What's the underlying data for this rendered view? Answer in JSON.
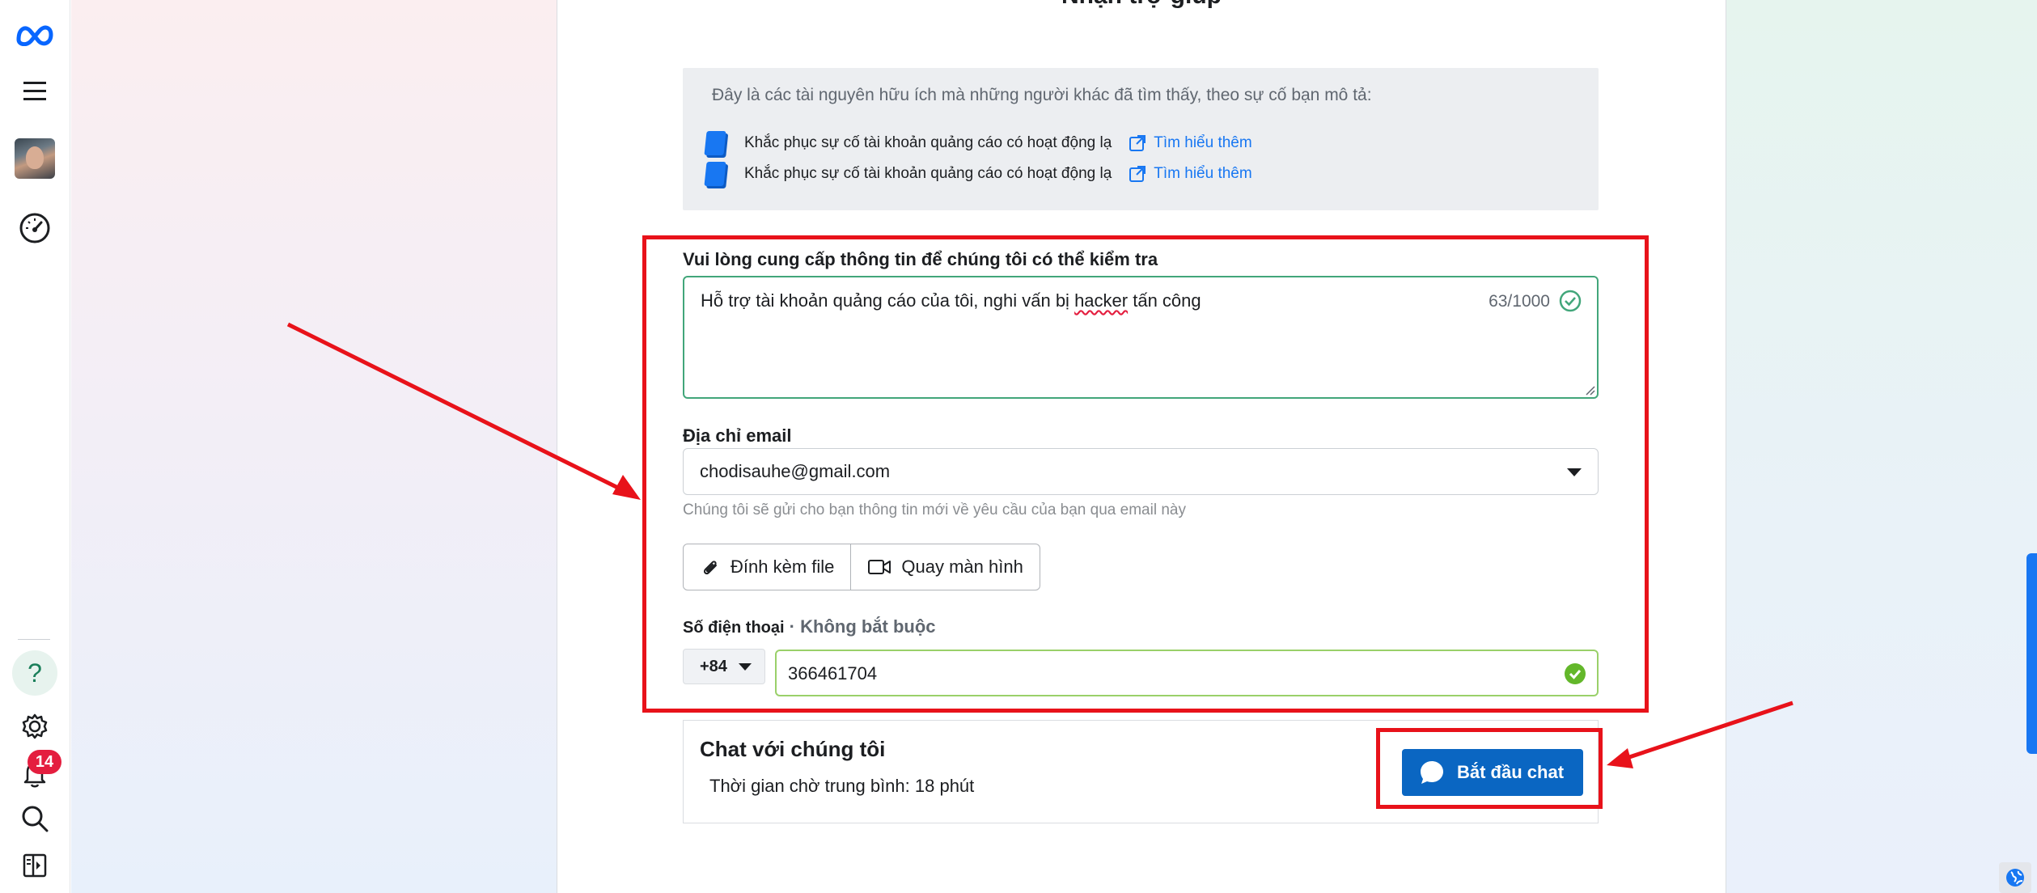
{
  "page_title": "Nhận trợ giúp",
  "resources": {
    "intro": "Đây là các tài nguyên hữu ích mà những người khác đã tìm thấy, theo sự cố bạn mô tả:",
    "items": [
      {
        "text": "Khắc phục sự cố tài khoản quảng cáo có hoạt động lạ",
        "link": "Tìm hiểu thêm"
      },
      {
        "text": "Khắc phục sự cố tài khoản quảng cáo có hoạt động lạ",
        "link": "Tìm hiểu thêm"
      }
    ]
  },
  "form": {
    "info_label": "Vui lòng cung cấp thông tin để chúng tôi có thể kiểm tra",
    "info_text_before": "Hỗ trợ tài khoản quảng cáo của tôi, nghi vấn bị ",
    "info_text_flagged": "hacker",
    "info_text_after": " tấn công",
    "char_count": "63/1000",
    "email_label": "Địa chỉ email",
    "email_value": "chodisauhe@gmail.com",
    "email_hint": "Chúng tôi sẽ gửi cho bạn thông tin mới về yêu cầu của bạn qua email này",
    "attach_label": "Đính kèm file",
    "record_label": "Quay màn hình",
    "phone_label": "Số điện thoại",
    "phone_optional": " · Không bắt buộc",
    "country_code": "+84",
    "phone_value": "366461704"
  },
  "chat": {
    "title": "Chat với chúng tôi",
    "wait_time": "Thời gian chờ trung bình: 18 phút",
    "start_button": "Bắt đầu chat"
  },
  "sidebar": {
    "notification_count": "14",
    "icons": [
      "meta-logo-icon",
      "menu-icon",
      "avatar",
      "dashboard-gauge-icon",
      "help-icon",
      "settings-gear-icon",
      "notification-bell-icon",
      "search-icon",
      "panel-toggle-icon"
    ]
  },
  "colors": {
    "annotation_red": "#e8121a",
    "primary_blue": "#0a66c2",
    "link_blue": "#1877f2",
    "success_green": "#42a67a",
    "badge_red": "#e41e3f"
  }
}
